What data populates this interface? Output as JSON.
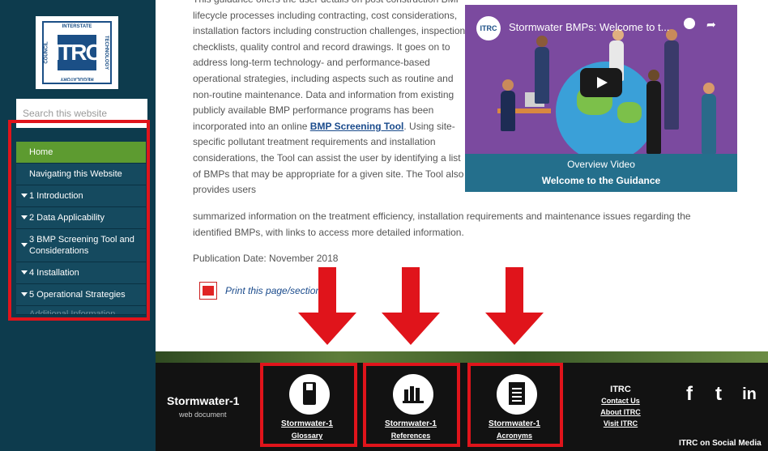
{
  "logo": {
    "text": "ITRC",
    "top": "INTERSTATE",
    "right": "TECHNOLOGY",
    "left": "COUNCIL",
    "bottom": "REGULATORY"
  },
  "search": {
    "placeholder": "Search this website"
  },
  "nav": {
    "items": [
      {
        "label": "Home"
      },
      {
        "label": "Navigating this Website"
      },
      {
        "label": "1 Introduction"
      },
      {
        "label": "2 Data Applicability"
      },
      {
        "label": "3 BMP Screening Tool and Considerations"
      },
      {
        "label": "4 Installation"
      },
      {
        "label": "5 Operational Strategies"
      },
      {
        "label": "Additional Information"
      }
    ]
  },
  "main": {
    "para1_a": "This guidance offers the user details on post construction BMP lifecycle processes including contracting, cost considerations, installation factors including construction challenges, inspection checklists, quality control and record drawings. It goes on to address long-term technology- and performance-based operational strategies, including aspects such as routine and non-routine maintenance. Data and information from existing publicly available BMP performance programs has been incorporated into an online ",
    "link": "BMP Screening Tool",
    "para1_b": ". Using site-specific pollutant treatment requirements and installation considerations, the Tool can assist the user by identifying a list of BMPs that may be appropriate for a given site. The Tool also provides users",
    "para2": "summarized information on the treatment efficiency, installation requirements and maintenance issues regarding the identified BMPs, with links to access more detailed information.",
    "pubdate": "Publication Date: November 2018",
    "print": "Print this page/section"
  },
  "video": {
    "logo": "ITRC",
    "title": "Stormwater BMPs: Welcome to t...",
    "caption1": "Overview Video",
    "caption2": "Welcome to the Guidance"
  },
  "footer": {
    "title": "Stormwater-1",
    "subtitle": "web document",
    "items": [
      {
        "label1": "Stormwater-1",
        "label2": "Glossary",
        "icon": "book-icon"
      },
      {
        "label1": "Stormwater-1",
        "label2": "References",
        "icon": "bookshelf-icon"
      },
      {
        "label1": "Stormwater-1",
        "label2": "Acronyms",
        "icon": "document-icon"
      }
    ],
    "itrc": {
      "heading": "ITRC",
      "links": [
        "Contact Us",
        "About ITRC",
        "Visit ITRC"
      ]
    },
    "social": {
      "icons": [
        "f",
        "t",
        "in"
      ],
      "caption": "ITRC on Social Media"
    }
  },
  "colors": {
    "sidebar": "#0d3b4d",
    "home_active": "#5d9b30",
    "annotation_red": "#e0141b",
    "link_blue": "#1a4b8c",
    "video_bg": "#246f8c",
    "footer_bg": "#121212"
  }
}
